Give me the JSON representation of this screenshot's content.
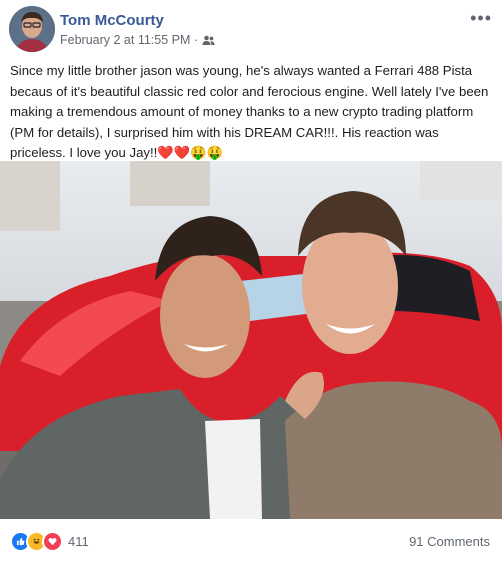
{
  "post": {
    "author": "Tom McCourty",
    "timestamp": "February 2 at 11:55 PM ·",
    "audience_icon": "friends-icon",
    "more_label": "•••",
    "text": "Since my little brother jason was young, he's always wanted a Ferrari 488 Pista becaus of it's beautiful classic red color and ferocious engine. Well lately I've been making a tremendous amount of money thanks to a new crypto trading platform (PM for details), I surprised him with his DREAM CAR!!!. His reaction was priceless. I love you Jay!!❤️❤️🤑🤑"
  },
  "footer": {
    "reaction_icons": [
      "like-icon",
      "haha-icon",
      "love-icon"
    ],
    "reaction_count": "411",
    "comments_label": "91 Comments"
  },
  "colors": {
    "author_link": "#385898",
    "meta_text": "#606770",
    "like_blue": "#1877f2",
    "love_red": "#f33e58",
    "haha_yellow": "#f7b928"
  }
}
